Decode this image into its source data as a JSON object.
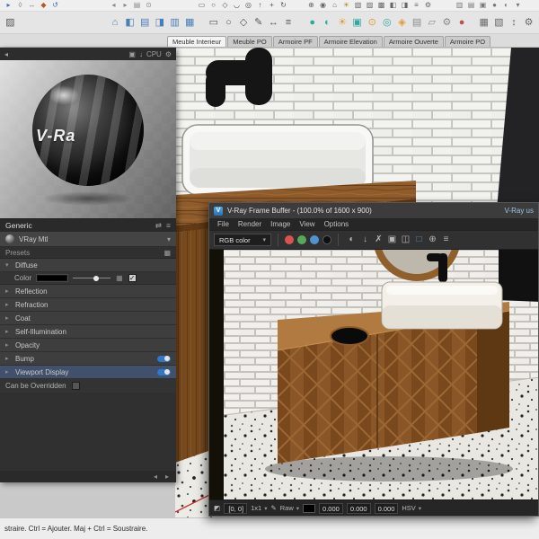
{
  "icons": {
    "back": "◂",
    "forward": "▸",
    "arrow": "▸",
    "arrow_down": "▾",
    "caret": "▾",
    "gear": "⚙",
    "dock": "▣",
    "download": "↓",
    "swap": "⇄",
    "menu": "≡",
    "grid": "▦",
    "checker": "▦",
    "check": "✓",
    "probe": "◩",
    "picker": "✎",
    "logo": "V"
  },
  "toolbars": {
    "row1": [
      {
        "name": "select-icon",
        "glyph": "▸",
        "color": "#3f6fae"
      },
      {
        "name": "eraser-icon",
        "glyph": "◊",
        "color": "#777"
      },
      {
        "name": "tape-measure-icon",
        "glyph": "↔",
        "color": "#777"
      },
      {
        "name": "paint-bucket-icon",
        "glyph": "◆",
        "color": "#b05a2a"
      },
      {
        "name": "orbit-icon",
        "glyph": "↺",
        "color": "#3f6fae"
      },
      {
        "name": "undo-icon",
        "glyph": "◂",
        "color": "#888",
        "gap": 52
      },
      {
        "name": "redo-icon",
        "glyph": "▸",
        "color": "#888"
      },
      {
        "name": "print-icon",
        "glyph": "▤",
        "color": "#888"
      },
      {
        "name": "model-info-icon",
        "glyph": "⊙",
        "color": "#888"
      },
      {
        "name": "rectangle-tool-icon",
        "glyph": "▭",
        "color": "#555",
        "gap": 46
      },
      {
        "name": "circle-tool-icon",
        "glyph": "○",
        "color": "#555"
      },
      {
        "name": "polygon-tool-icon",
        "glyph": "◇",
        "color": "#555"
      },
      {
        "name": "arc-tool-icon",
        "glyph": "◡",
        "color": "#555"
      },
      {
        "name": "offset-tool-icon",
        "glyph": "◎",
        "color": "#555"
      },
      {
        "name": "pushpull-tool-icon",
        "glyph": "↑",
        "color": "#555"
      },
      {
        "name": "move-tool-icon",
        "glyph": "+",
        "color": "#555"
      },
      {
        "name": "rotate-tool-icon",
        "glyph": "↻",
        "color": "#555"
      },
      {
        "name": "walk-icon",
        "glyph": "⊕",
        "color": "#666",
        "gap": 18
      },
      {
        "name": "look-around-icon",
        "glyph": "◉",
        "color": "#666"
      },
      {
        "name": "home-view-icon",
        "glyph": "⌂",
        "color": "#666"
      },
      {
        "name": "shadows-icon",
        "glyph": "☀",
        "color": "#b08a2a"
      },
      {
        "name": "styles-icon",
        "glyph": "▧",
        "color": "#666"
      },
      {
        "name": "materials-icon",
        "glyph": "▨",
        "color": "#666"
      },
      {
        "name": "layers-icon",
        "glyph": "▩",
        "color": "#666"
      },
      {
        "name": "half-style-icon",
        "glyph": "◧",
        "color": "#666"
      },
      {
        "name": "half-style2-icon",
        "glyph": "◨",
        "color": "#666"
      },
      {
        "name": "outliner-icon",
        "glyph": "≡",
        "color": "#666"
      },
      {
        "name": "settings-icon",
        "glyph": "⚙",
        "color": "#666"
      },
      {
        "name": "section-icon",
        "glyph": "▥",
        "color": "#777",
        "gap": 22
      },
      {
        "name": "scenes-icon",
        "glyph": "▤",
        "color": "#777"
      },
      {
        "name": "frame-icon",
        "glyph": "▣",
        "color": "#777"
      },
      {
        "name": "sphere-icon",
        "glyph": "●",
        "color": "#777"
      },
      {
        "name": "contrast-icon",
        "glyph": "◐",
        "color": "#777"
      },
      {
        "name": "more-icon",
        "glyph": "▾",
        "color": "#777"
      }
    ],
    "row2": [
      {
        "name": "styles-toggle-icon",
        "glyph": "▨",
        "color": "#5a5a5a"
      },
      {
        "name": "iso-view-icon",
        "glyph": "⌂",
        "color": "#4a7fb5",
        "gap": 100
      },
      {
        "name": "top-view-icon",
        "glyph": "◧",
        "color": "#4a7fb5"
      },
      {
        "name": "front-view-icon",
        "glyph": "▤",
        "color": "#4a7fb5"
      },
      {
        "name": "right-view-icon",
        "glyph": "◨",
        "color": "#4a7fb5"
      },
      {
        "name": "back-view-icon",
        "glyph": "▥",
        "color": "#4a7fb5"
      },
      {
        "name": "left-view-icon",
        "glyph": "▦",
        "color": "#4a7fb5"
      },
      {
        "name": "rectangle-icon",
        "glyph": "▭",
        "color": "#555",
        "gap": 10
      },
      {
        "name": "circle-icon",
        "glyph": "○",
        "color": "#555"
      },
      {
        "name": "polygon-icon",
        "glyph": "◇",
        "color": "#555"
      },
      {
        "name": "freehand-icon",
        "glyph": "✎",
        "color": "#555"
      },
      {
        "name": "dimension-icon",
        "glyph": "↔",
        "color": "#555"
      },
      {
        "name": "text-icon",
        "glyph": "≡",
        "color": "#555"
      },
      {
        "name": "vray-asset-editor-icon",
        "glyph": "●",
        "color": "#2fa8a0",
        "gap": 10
      },
      {
        "name": "vray-render-icon",
        "glyph": "◐",
        "color": "#2fa8a0"
      },
      {
        "name": "vray-interactive-icon",
        "glyph": "☀",
        "color": "#e09b3a"
      },
      {
        "name": "vray-frame-buffer-icon",
        "glyph": "▣",
        "color": "#2fa8a0"
      },
      {
        "name": "vray-batch-icon",
        "glyph": "⊙",
        "color": "#e09b3a"
      },
      {
        "name": "vray-viewport-icon",
        "glyph": "◎",
        "color": "#2fa8a0"
      },
      {
        "name": "vray-lights-icon",
        "glyph": "◈",
        "color": "#e09b3a"
      },
      {
        "name": "vray-objects-icon",
        "glyph": "▤",
        "color": "#8a8a8a"
      },
      {
        "name": "vray-infinite-plane-icon",
        "glyph": "▱",
        "color": "#8a8a8a"
      },
      {
        "name": "vray-settings-icon",
        "glyph": "⚙",
        "color": "#8a8a8a"
      },
      {
        "name": "vray-stop-icon",
        "glyph": "●",
        "color": "#c0504d"
      },
      {
        "name": "grid-a-icon",
        "glyph": "▦",
        "color": "#6a6a6a",
        "gap": 8
      },
      {
        "name": "grid-b-icon",
        "glyph": "▧",
        "color": "#6a6a6a"
      },
      {
        "name": "resize-icon",
        "glyph": "↕",
        "color": "#6a6a6a"
      },
      {
        "name": "prefs-icon",
        "glyph": "⚙",
        "color": "#6a6a6a"
      }
    ]
  },
  "tabs": {
    "items": [
      {
        "label": "Meuble Interieur",
        "active": true
      },
      {
        "label": "Meuble PO"
      },
      {
        "label": "Armoire PF"
      },
      {
        "label": "Armoire Elevation"
      },
      {
        "label": "Armoire Ouverte"
      },
      {
        "label": "Armoire PO"
      }
    ]
  },
  "asset_editor": {
    "device_label": "CPU",
    "watermark": "V-Ra",
    "header_title": "Generic",
    "material_name": "VRay Mtl",
    "presets_label": "Presets",
    "diffuse_label": "Diffuse",
    "color_label": "Color",
    "sections": [
      {
        "label": "Reflection"
      },
      {
        "label": "Refraction"
      },
      {
        "label": "Coat"
      },
      {
        "label": "Self-Illumination"
      },
      {
        "label": "Opacity"
      },
      {
        "label": "Bump",
        "toggle": true
      },
      {
        "label": "Viewport Display",
        "toggle": true,
        "selected": true
      }
    ],
    "override_label": "Can be Overridden"
  },
  "vfb": {
    "title": "V-Ray Frame Buffer - (100.0% of 1600 x 900)",
    "title_right": "V-Ray us",
    "menus": [
      {
        "label": "File"
      },
      {
        "label": "Render"
      },
      {
        "label": "Image"
      },
      {
        "label": "View"
      },
      {
        "label": "Options"
      }
    ],
    "channel_selector": "RGB color",
    "tools": [
      {
        "name": "lens-effects-icon",
        "glyph": "◐"
      },
      {
        "name": "save-image-icon",
        "glyph": "↓"
      },
      {
        "name": "clear-image-icon",
        "glyph": "✗"
      },
      {
        "name": "duplicate-to-host-icon",
        "glyph": "▣"
      },
      {
        "name": "compare-images-icon",
        "glyph": "◫"
      },
      {
        "name": "region-render-icon",
        "glyph": "□",
        "color": "#4f93d1"
      },
      {
        "name": "track-mouse-icon",
        "glyph": "⊕"
      },
      {
        "name": "stamp-icon",
        "glyph": "≡"
      }
    ],
    "status": {
      "coords": "[0, 0]",
      "zoom": "1x1",
      "raw_label": "Raw",
      "r": "0.000",
      "g": "0.000",
      "b": "0.000",
      "colorspace": "HSV"
    }
  },
  "statusbar": {
    "hint": "straire. Ctrl = Ajouter. Maj + Ctrl = Soustraire."
  }
}
